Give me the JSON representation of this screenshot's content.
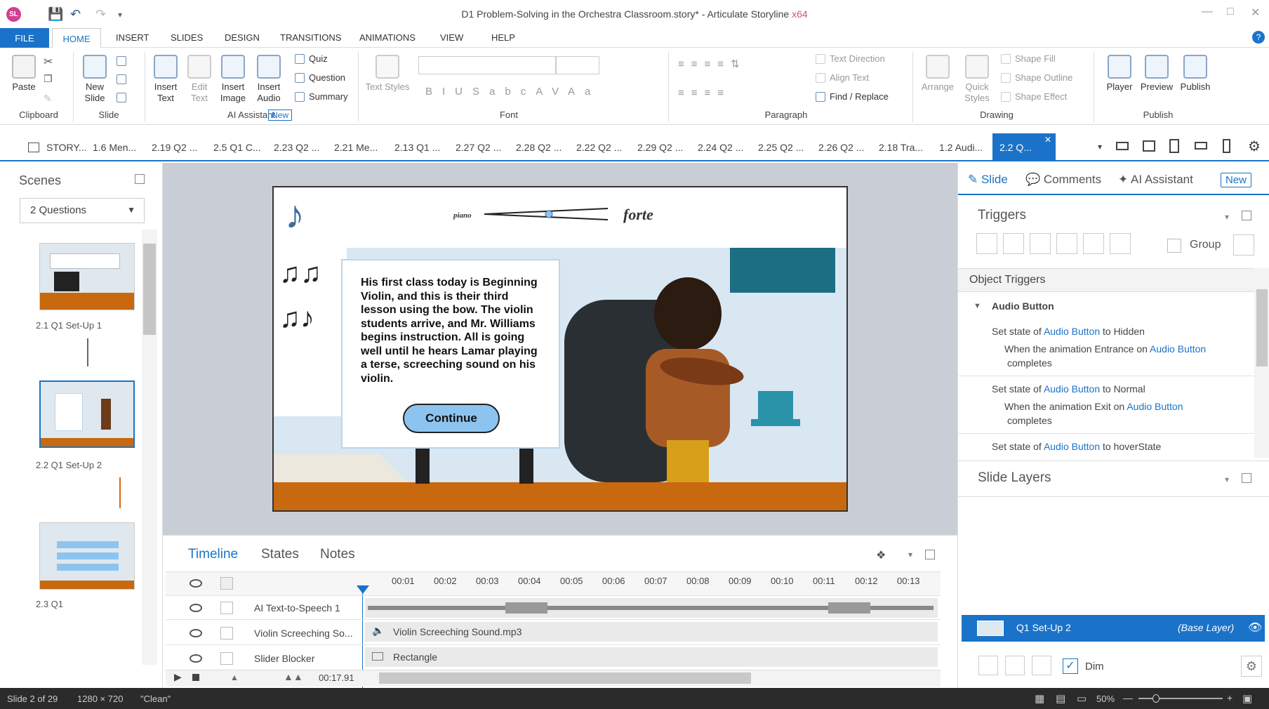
{
  "title_bar": {
    "app_badge": "SL",
    "title": "D1 Problem-Solving in the Orchestra Classroom.story* - Articulate Storyline ",
    "arch": "x64"
  },
  "ribbon_tabs": [
    "FILE",
    "HOME",
    "INSERT",
    "SLIDES",
    "DESIGN",
    "TRANSITIONS",
    "ANIMATIONS",
    "VIEW",
    "HELP"
  ],
  "ribbon": {
    "paste": "Paste",
    "clipboard": "Clipboard",
    "new_slide": "New Slide",
    "slide_group": "Slide",
    "insert_text": "Insert Text",
    "edit_text": "Edit Text",
    "insert_image": "Insert Image",
    "insert_audio": "Insert Audio",
    "quiz": "Quiz",
    "question": "Question",
    "summary": "Summary",
    "ai_assistant": "AI Assistant",
    "new_badge": "New",
    "text_styles": "Text Styles",
    "font_group": "Font",
    "text_direction": "Text Direction",
    "align_text": "Align Text",
    "find_replace": "Find / Replace",
    "paragraph_group": "Paragraph",
    "arrange": "Arrange",
    "quick_styles": "Quick Styles",
    "shape_fill": "Shape Fill",
    "shape_outline": "Shape Outline",
    "shape_effect": "Shape Effect",
    "drawing_group": "Drawing",
    "player": "Player",
    "preview": "Preview",
    "publish": "Publish",
    "publish_group": "Publish"
  },
  "doc_tabs": [
    "STORY...",
    "1.6 Men...",
    "2.19 Q2 ...",
    "2.5 Q1 C...",
    "2.23 Q2 ...",
    "2.21 Me...",
    "2.13 Q1 ...",
    "2.27 Q2 ...",
    "2.28 Q2 ...",
    "2.22 Q2 ...",
    "2.29 Q2 ...",
    "2.24 Q2 ...",
    "2.25 Q2 ...",
    "2.26 Q2 ...",
    "2.18 Tra...",
    "1.2 Audi..."
  ],
  "active_doc_tab": "2.2 Q...",
  "scenes": {
    "title": "Scenes",
    "dropdown": "2 Questions",
    "slides": [
      "2.1 Q1 Set-Up 1",
      "2.2 Q1 Set-Up 2",
      "2.3 Q1"
    ]
  },
  "slide": {
    "piano": "piano",
    "forte": "forte",
    "body": "His first class today is Beginning Violin, and this is their third lesson using the bow. The violin students arrive, and Mr. Williams begins instruction. All is going well until he hears Lamar playing a terse, screeching sound on his violin.",
    "continue": "Continue"
  },
  "timeline": {
    "tabs": [
      "Timeline",
      "States",
      "Notes"
    ],
    "ticks": [
      "00:01",
      "00:02",
      "00:03",
      "00:04",
      "00:05",
      "00:06",
      "00:07",
      "00:08",
      "00:09",
      "00:10",
      "00:11",
      "00:12",
      "00:13"
    ],
    "rows": [
      {
        "name": "AI Text-to-Speech 1",
        "item": ""
      },
      {
        "name": "Violin Screeching So...",
        "item": "Violin Screeching Sound.mp3"
      },
      {
        "name": "Slider Blocker",
        "item": "Rectangle"
      }
    ],
    "time": "00:17.91"
  },
  "right_panel": {
    "tabs": [
      "Slide",
      "Comments",
      "AI Assistant"
    ],
    "new_badge": "New",
    "triggers": "Triggers",
    "group": "Group",
    "object_triggers": "Object Triggers",
    "audio_button": "Audio Button",
    "t1_a": "Set state of ",
    "t1_link": "Audio Button",
    "t1_b": " to Hidden",
    "t1_when": "When the animation Entrance on ",
    "t1_when_link": "Audio Button",
    "t1_complete": "completes",
    "t2_a": "Set state of ",
    "t2_link": "Audio Button",
    "t2_b": " to Normal",
    "t2_when": "When the animation Exit on ",
    "t2_when_link": "Audio Button",
    "t2_complete": "completes",
    "t3_a": "Set state of ",
    "t3_link": "Audio Button",
    "t3_b": " to hoverState",
    "slide_layers": "Slide Layers",
    "layer_name": "Q1 Set-Up 2",
    "layer_tag": "(Base Layer)",
    "dim": "Dim"
  },
  "status": {
    "slide": "Slide 2 of 29",
    "size": "1280 × 720",
    "theme": "\"Clean\"",
    "zoom": "50%"
  },
  "colors": {
    "accent": "#1a73c8",
    "slide_btn": "#8dc4ef"
  }
}
